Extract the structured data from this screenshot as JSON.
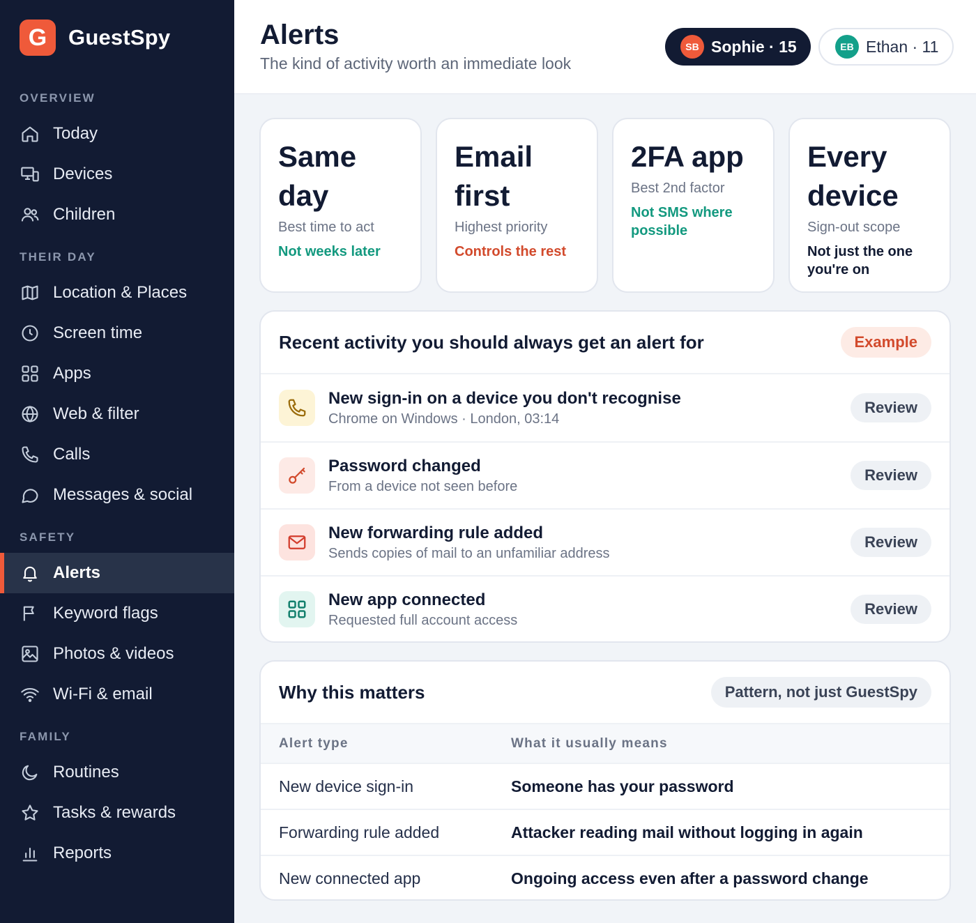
{
  "brand": {
    "logo_letter": "G",
    "name": "GuestSpy"
  },
  "sidebar": {
    "sections": [
      {
        "label": "OVERVIEW"
      },
      {
        "label": "THEIR DAY"
      },
      {
        "label": "SAFETY"
      },
      {
        "label": "FAMILY"
      }
    ],
    "items": [
      {
        "label": "Today",
        "icon": "home-icon"
      },
      {
        "label": "Devices",
        "icon": "devices-icon"
      },
      {
        "label": "Children",
        "icon": "users-icon"
      },
      {
        "label": "Location & Places",
        "icon": "map-icon"
      },
      {
        "label": "Screen time",
        "icon": "clock-icon"
      },
      {
        "label": "Apps",
        "icon": "grid-icon"
      },
      {
        "label": "Web & filter",
        "icon": "globe-icon"
      },
      {
        "label": "Calls",
        "icon": "phone-icon"
      },
      {
        "label": "Messages & social",
        "icon": "chat-icon"
      },
      {
        "label": "Alerts",
        "icon": "bell-icon",
        "active": true
      },
      {
        "label": "Keyword flags",
        "icon": "flag-icon"
      },
      {
        "label": "Photos & videos",
        "icon": "image-icon"
      },
      {
        "label": "Wi-Fi & email",
        "icon": "wifi-icon"
      },
      {
        "label": "Routines",
        "icon": "moon-icon"
      },
      {
        "label": "Tasks & rewards",
        "icon": "star-icon"
      },
      {
        "label": "Reports",
        "icon": "bar-chart-icon"
      }
    ]
  },
  "header": {
    "title": "Alerts",
    "subtitle": "The kind of activity worth an immediate look",
    "children": [
      {
        "initials": "SB",
        "label": "Sophie · 15",
        "selected": true
      },
      {
        "initials": "EB",
        "label": "Ethan · 11",
        "selected": false
      }
    ]
  },
  "stats": [
    {
      "title_line1": "Same",
      "title_line2": "day",
      "sub": "Best time to act",
      "note": "Not weeks later"
    },
    {
      "title_line1": "Email",
      "title_line2": "first",
      "sub": "Highest priority",
      "note": "Controls the rest"
    },
    {
      "title_line1": "2FA app",
      "title_line2": "",
      "sub": "Best 2nd factor",
      "note": "Not SMS where possible"
    },
    {
      "title_line1": "Every",
      "title_line2": "device",
      "sub": "Sign-out scope",
      "note": "Not just the one you're on"
    }
  ],
  "recent": {
    "title": "Recent activity you should always get an alert for",
    "badge": "Example",
    "items": [
      {
        "icon": "phone-icon",
        "title": "New sign-in on a device you don't recognise",
        "detail": "Chrome on Windows · London, 03:14",
        "action": "Review"
      },
      {
        "icon": "key-icon",
        "title": "Password changed",
        "detail": "From a device not seen before",
        "action": "Review"
      },
      {
        "icon": "mail-icon",
        "title": "New forwarding rule added",
        "detail": "Sends copies of mail to an unfamiliar address",
        "action": "Review"
      },
      {
        "icon": "grid-icon",
        "title": "New app connected",
        "detail": "Requested full account access",
        "action": "Review"
      }
    ]
  },
  "why": {
    "title": "Why this matters",
    "badge": "Pattern, not just GuestSpy",
    "columns": [
      "Alert type",
      "What it usually means"
    ],
    "rows": [
      {
        "type": "New device sign-in",
        "meaning": "Someone has your password"
      },
      {
        "type": "Forwarding rule added",
        "meaning": "Attacker reading mail without logging in again"
      },
      {
        "type": "New connected app",
        "meaning": "Ongoing access even after a password change"
      }
    ]
  },
  "colors": {
    "accent": "#ef5a3a",
    "sidebar_bg": "#121b33",
    "green": "#13997f",
    "red": "#d24a2c"
  }
}
